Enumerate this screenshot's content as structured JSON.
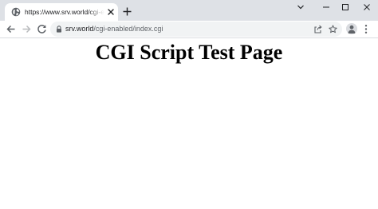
{
  "browser": {
    "tab": {
      "title": "https://www.srv.world/cgi-enabled/index.cgi"
    },
    "address_bar": {
      "host": "srv.world",
      "path": "/cgi-enabled/index.cgi"
    },
    "colors": {
      "tabstrip": "#dee1e6",
      "omnibox": "#f1f3f4",
      "icon": "#5f6368"
    }
  },
  "page": {
    "heading": "CGI Script Test Page"
  }
}
